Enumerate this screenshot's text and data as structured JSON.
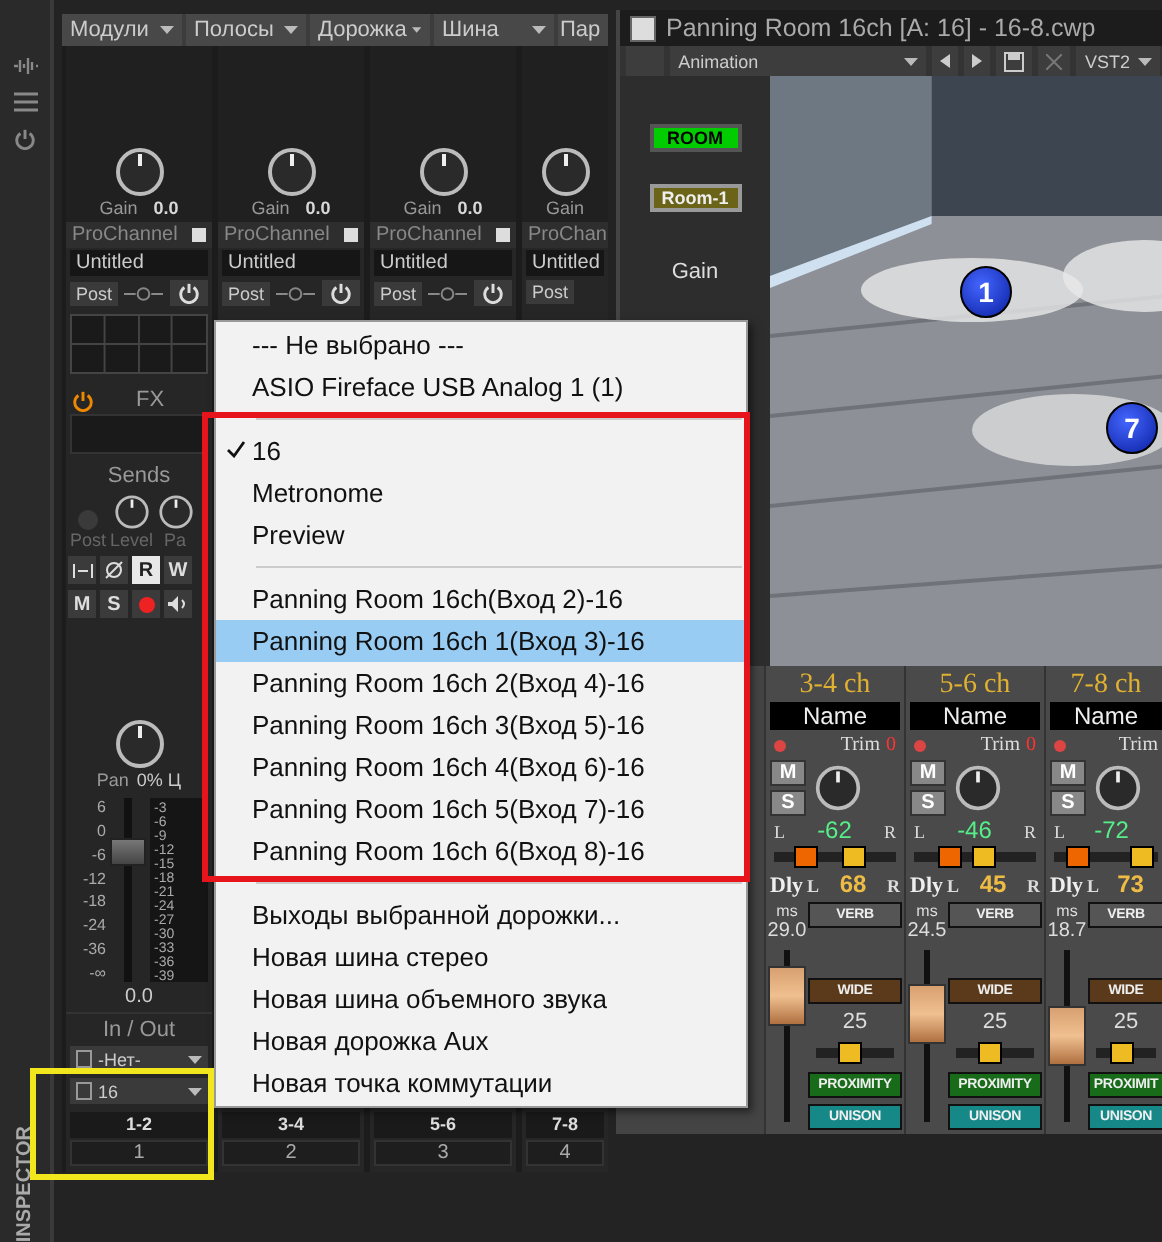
{
  "sidebar": {
    "label": "INSPECTOR"
  },
  "mixer_menu": [
    "Модули",
    "Полосы",
    "Дорожка",
    "Шина",
    "Пар"
  ],
  "strips": [
    {
      "gain_label": "Gain",
      "gain_value": "0.0",
      "prochannel": "ProChannel",
      "preset": "Untitled",
      "post": "Post",
      "bus": "1-2",
      "number": "1"
    },
    {
      "gain_label": "Gain",
      "gain_value": "0.0",
      "prochannel": "ProChannel",
      "preset": "Untitled",
      "post": "Post",
      "bus": "3-4",
      "number": "2"
    },
    {
      "gain_label": "Gain",
      "gain_value": "0.0",
      "prochannel": "ProChannel",
      "preset": "Untitled",
      "post": "Post",
      "bus": "5-6",
      "number": "3"
    },
    {
      "gain_label": "Gain",
      "prochannel": "ProChan",
      "preset": "Untitled",
      "post": "Post",
      "bus": "7-8",
      "number": "4"
    }
  ],
  "track": {
    "fx": "FX",
    "sends": "Sends",
    "send_labels": [
      "Post",
      "Level",
      "Pa"
    ],
    "buttons": [
      {
        "label": "R",
        "on": true
      },
      {
        "label": "W",
        "on": false
      }
    ],
    "buttons_2": [
      {
        "label": "M",
        "on": false
      },
      {
        "label": "S",
        "on": false
      }
    ],
    "record_armed": true,
    "pan_label": "Pan",
    "pan_value": "0% Ц",
    "fader_scale": [
      "6",
      "0",
      "-6",
      "-12",
      "-18",
      "-24",
      "-36",
      "-∞"
    ],
    "meter_scale": [
      "-3",
      "-6",
      "-9",
      "-12",
      "-15",
      "-18",
      "-21",
      "-24",
      "-27",
      "-30",
      "-33",
      "-36",
      "-39"
    ],
    "level": 0.75,
    "fader_value": "0.0",
    "in_out": "In / Out",
    "input": "-Нет-",
    "output": "16"
  },
  "plugin": {
    "title": "Panning Room 16ch [A: 16] - 16-8.cwp",
    "preset": "Animation",
    "format": "VST2",
    "room_button": "ROOM",
    "room_preset": "Room-1",
    "gain_label": "Gain",
    "speakers": [
      "1",
      "7"
    ],
    "channels": [
      {
        "name": "3-4 ch",
        "label": "Name",
        "trim": "Trim",
        "trim_value": "0",
        "mute": "M",
        "solo": "S",
        "pan_l": "L",
        "pan_value": "-62",
        "pan_r": "R",
        "pan_slider": {
          "level": 0.2
        },
        "width_slider": {
          "level": 0.7
        },
        "dly": "Dly",
        "width_l": "L",
        "width_value": "68",
        "width_r": "R",
        "ms": "ms",
        "delay": "29.0",
        "level": 0.85,
        "amount_slider": {
          "level": 0.4
        },
        "verb": "VERB",
        "wide": "WIDE",
        "amount": "25",
        "proximity": "PROXIMITY",
        "unison": "UNISON"
      },
      {
        "name": "5-6 ch",
        "label": "Name",
        "trim": "Trim",
        "trim_value": "0",
        "mute": "M",
        "solo": "S",
        "pan_l": "L",
        "pan_value": "-46",
        "pan_r": "R",
        "pan_slider": {
          "level": 0.25
        },
        "width_slider": {
          "level": 0.6
        },
        "dly": "Dly",
        "width_l": "L",
        "width_value": "45",
        "width_r": "R",
        "ms": "ms",
        "delay": "24.5",
        "level": 0.7,
        "amount_slider": {
          "level": 0.4
        },
        "verb": "VERB",
        "wide": "WIDE",
        "amount": "25",
        "proximity": "PROXIMITY",
        "unison": "UNISON"
      },
      {
        "name": "7-8 ch",
        "label": "Name",
        "trim": "Trim",
        "mute": "M",
        "solo": "S",
        "pan_l": "L",
        "pan_value": "-72",
        "pan_slider": {
          "level": 0.15
        },
        "width_slider": {
          "level": 0.95
        },
        "dly": "Dly",
        "width_l": "L",
        "width_value": "73",
        "ms": "ms",
        "delay": "18.7",
        "level": 0.5,
        "amount_slider": {
          "level": 0.4
        },
        "verb": "VERB",
        "wide": "WIDE",
        "amount": "25",
        "proximity": "PROXIMIT",
        "unison": "UNISON"
      }
    ]
  },
  "menu": {
    "sections": [
      [
        {
          "label": "--- Не выбрано ---",
          "checked": false,
          "selected": false
        },
        {
          "label": "ASIO Fireface USB Analog 1 (1)",
          "checked": false,
          "selected": false
        }
      ],
      [
        {
          "label": "16",
          "checked": true,
          "selected": false
        },
        {
          "label": "Metronome",
          "checked": false,
          "selected": false
        },
        {
          "label": "Preview",
          "checked": false,
          "selected": false
        }
      ],
      [
        {
          "label": "Panning Room 16ch(Вход 2)-16",
          "checked": false,
          "selected": false
        },
        {
          "label": "Panning Room 16ch 1(Вход 3)-16",
          "checked": false,
          "selected": true
        },
        {
          "label": "Panning Room 16ch 2(Вход 4)-16",
          "checked": false,
          "selected": false
        },
        {
          "label": "Panning Room 16ch 3(Вход 5)-16",
          "checked": false,
          "selected": false
        },
        {
          "label": "Panning Room 16ch 4(Вход 6)-16",
          "checked": false,
          "selected": false
        },
        {
          "label": "Panning Room 16ch 5(Вход 7)-16",
          "checked": false,
          "selected": false
        },
        {
          "label": "Panning Room 16ch 6(Вход 8)-16",
          "checked": false,
          "selected": false
        }
      ],
      [
        {
          "label": "Выходы выбранной дорожки...",
          "checked": false,
          "selected": false
        },
        {
          "label": "Новая шина стерео",
          "checked": false,
          "selected": false
        },
        {
          "label": "Новая шина объемного звука",
          "checked": false,
          "selected": false
        },
        {
          "label": "Новая дорожка Aux",
          "checked": false,
          "selected": false
        },
        {
          "label": "Новая точка коммутации",
          "checked": false,
          "selected": false
        }
      ]
    ]
  },
  "highlight_frames": [
    {
      "color": "#e8141c"
    },
    {
      "color": "#f2e61c"
    }
  ]
}
